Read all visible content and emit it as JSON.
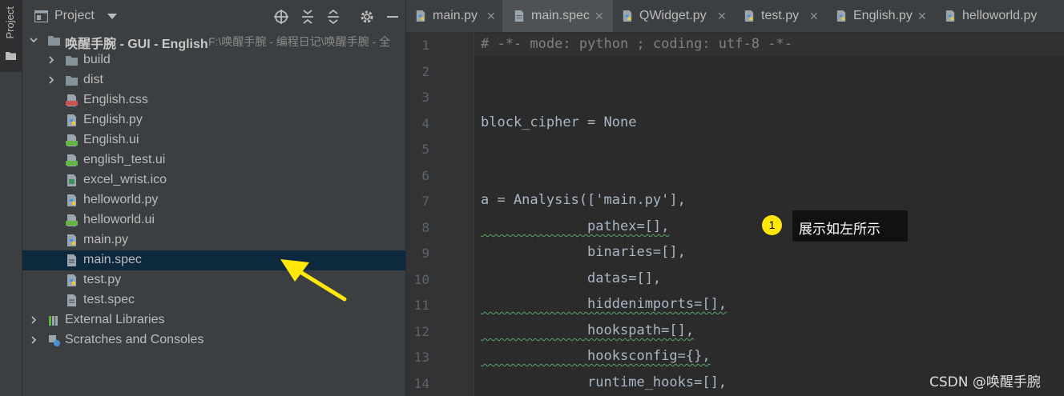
{
  "sidebar": {
    "project_tab_label": "Project"
  },
  "project_panel": {
    "title": "Project",
    "tree": [
      {
        "label": "唤醒手腕 - GUI - English",
        "path": "F:\\唤醒手腕 - 编程日记\\唤醒手腕 - 全",
        "icon": "folder-icon",
        "expanded": true
      },
      {
        "label": "build",
        "icon": "folder-icon"
      },
      {
        "label": "dist",
        "icon": "folder-icon"
      },
      {
        "label": "English.css",
        "icon": "css-file-icon"
      },
      {
        "label": "English.py",
        "icon": "python-file-icon"
      },
      {
        "label": "English.ui",
        "icon": "qt-file-icon"
      },
      {
        "label": "english_test.ui",
        "icon": "qt-file-icon"
      },
      {
        "label": "excel_wrist.ico",
        "icon": "image-file-icon"
      },
      {
        "label": "helloworld.py",
        "icon": "python-file-icon"
      },
      {
        "label": "helloworld.ui",
        "icon": "qt-file-icon"
      },
      {
        "label": "main.py",
        "icon": "python-file-icon"
      },
      {
        "label": "main.spec",
        "icon": "text-file-icon",
        "selected": true
      },
      {
        "label": "test.py",
        "icon": "python-file-icon"
      },
      {
        "label": "test.spec",
        "icon": "text-file-icon"
      },
      {
        "label": "External Libraries",
        "icon": "library-icon"
      },
      {
        "label": "Scratches and Consoles",
        "icon": "scratches-icon"
      }
    ]
  },
  "editor": {
    "tabs": [
      {
        "label": "main.py",
        "icon": "python-file-icon"
      },
      {
        "label": "main.spec",
        "icon": "text-file-icon",
        "active": true
      },
      {
        "label": "QWidget.py",
        "icon": "python-file-icon"
      },
      {
        "label": "test.py",
        "icon": "python-file-icon"
      },
      {
        "label": "English.py",
        "icon": "python-file-icon"
      },
      {
        "label": "helloworld.py",
        "icon": "python-file-icon"
      }
    ],
    "lines": [
      "# -*- mode: python ; coding: utf-8 -*-",
      "",
      "",
      "block_cipher = None",
      "",
      "",
      "a = Analysis(['main.py'],",
      "             pathex=[],",
      "             binaries=[],",
      "             datas=[],",
      "             hiddenimports=[],",
      "             hookspath=[],",
      "             hooksconfig={},",
      "             runtime_hooks=[],"
    ],
    "line_numbers": [
      "1",
      "2",
      "3",
      "4",
      "5",
      "6",
      "7",
      "8",
      "9",
      "10",
      "11",
      "12",
      "13",
      "14"
    ]
  },
  "callout": {
    "number": "1",
    "text": "展示如左所示"
  },
  "watermark": "CSDN @唤醒手腕",
  "colors": {
    "accent_callout": "#ffe70a",
    "arrow": "#ffe70a",
    "selection": "#0d293e"
  }
}
